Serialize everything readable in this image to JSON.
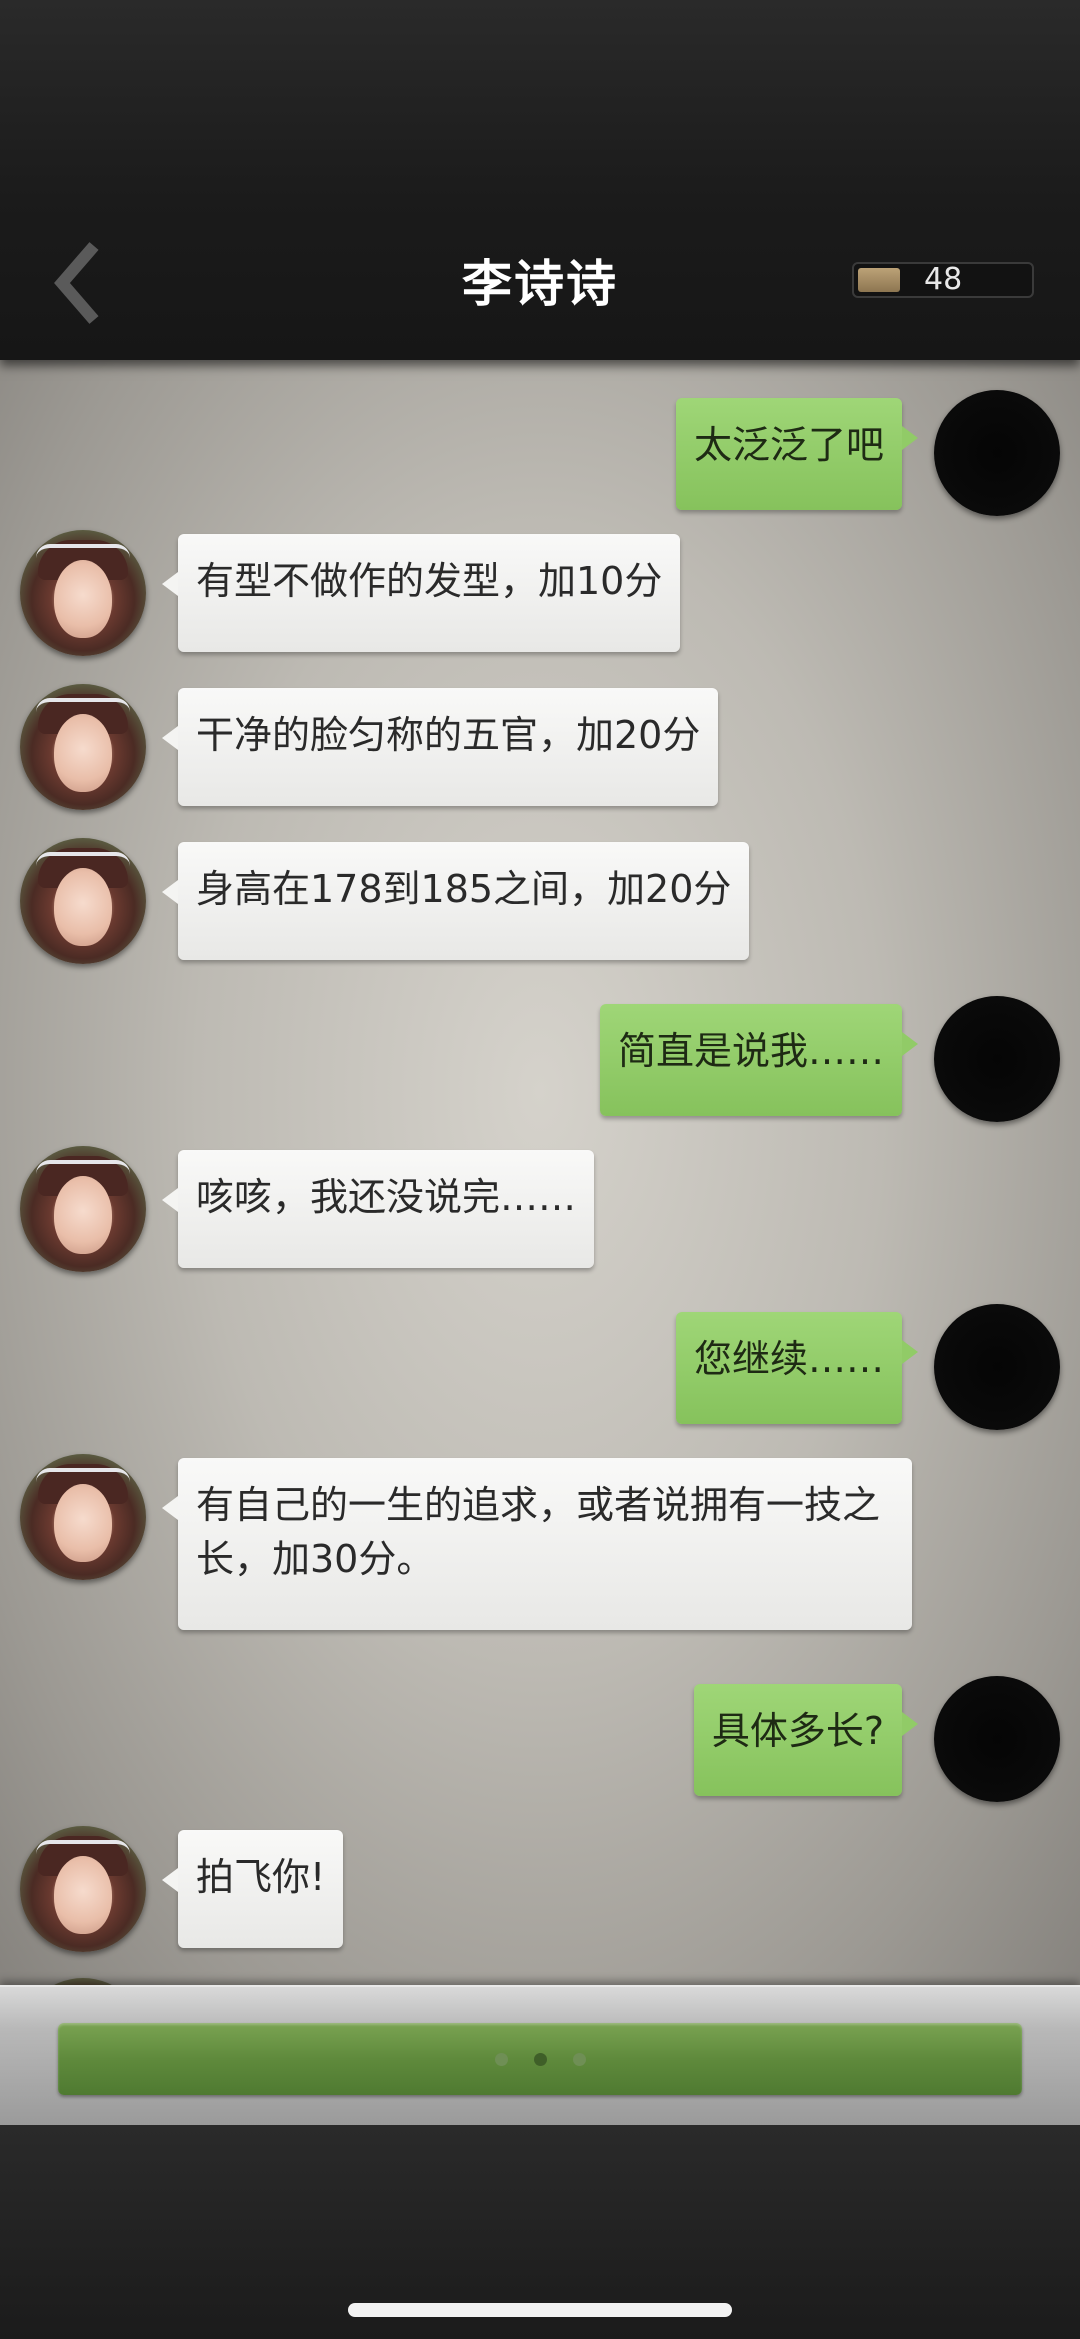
{
  "header": {
    "title": "李诗诗",
    "counter_value": "48",
    "back_icon": "chevron-left-icon"
  },
  "messages": [
    {
      "side": "right",
      "text": "太泛泛了吧"
    },
    {
      "side": "left",
      "text": "有型不做作的发型，加10分"
    },
    {
      "side": "left",
      "text": "干净的脸匀称的五官，加20分"
    },
    {
      "side": "left",
      "text": "身高在178到185之间，加20分"
    },
    {
      "side": "right",
      "text": "简直是说我……"
    },
    {
      "side": "left",
      "text": "咳咳，我还没说完……"
    },
    {
      "side": "right",
      "text": "您继续……"
    },
    {
      "side": "left",
      "text": "有自己的一生的追求，或者说拥有一技之长，加30分。"
    },
    {
      "side": "right",
      "text": "具体多长?"
    },
    {
      "side": "left",
      "text": "拍飞你!"
    }
  ],
  "action_bar": {
    "dots": [
      "inactive",
      "active",
      "inactive"
    ]
  },
  "colors": {
    "user_bubble": "#8fcb64",
    "other_bubble": "#f2f2f0",
    "action_bar": "#5f8a3c"
  }
}
